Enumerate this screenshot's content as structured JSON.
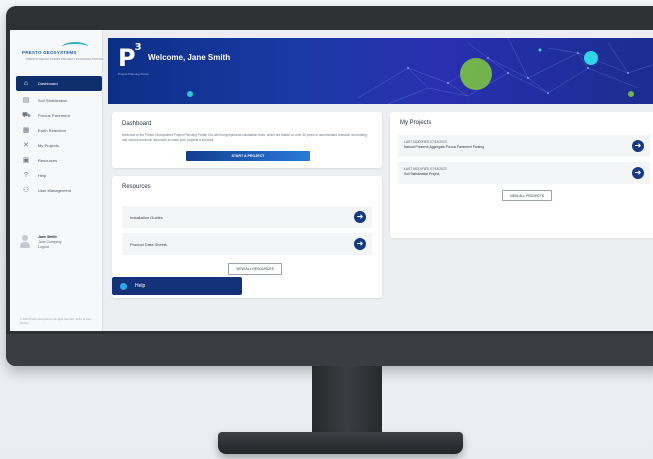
{
  "brand": {
    "logo_text": "PRESTO GEOSYSTEMS",
    "logo_sub": "PRESTO GEOSYSTEMS PROJECT PLANNING PORTAL"
  },
  "sidebar": {
    "items": [
      {
        "label": "Dashboard",
        "icon": "home-icon",
        "active": true
      },
      {
        "label": "Soil Stabilization",
        "icon": "layers-icon",
        "active": false
      },
      {
        "label": "Porous Pavement",
        "icon": "car-icon",
        "active": false
      },
      {
        "label": "Earth Retention",
        "icon": "wall-icon",
        "active": false
      },
      {
        "label": "My Projects",
        "icon": "projects-icon",
        "active": false
      },
      {
        "label": "Resources",
        "icon": "book-icon",
        "active": false
      },
      {
        "label": "Help",
        "icon": "question-icon",
        "active": false
      },
      {
        "label": "User Management",
        "icon": "users-icon",
        "active": false
      }
    ],
    "user": {
      "name": "Jane Smith",
      "line2": "Jane Company",
      "line3": "Logout"
    },
    "copyright": "© 2024 Presto Geosystems. All rights reserved. Terms of Use | Privacy"
  },
  "hero": {
    "logo": "P",
    "logo_sup": "3",
    "logo_sub": "Project Planning Portal",
    "welcome": "Welcome, Jane Smith"
  },
  "dashboard": {
    "title": "Dashboard",
    "body": "Welcome to the Presto Geosystems Project Planning Portal! You will find geoproduct calculation tools, which are based on over 40 years of accumulated research and testing, and various technical resources to make your projects a success.",
    "start_label": "START A PROJECT"
  },
  "resources": {
    "title": "Resources",
    "rows": [
      "Installation Guides",
      "Product Data Sheets"
    ],
    "view_all": "VIEW ALL RESOURCES"
  },
  "projects": {
    "title": "My Projects",
    "rows": [
      {
        "meta": "LAST MODIFIED 07/13/2023",
        "name": "Natural Preserve Aggregate Porous Pavement Parking"
      },
      {
        "meta": "LAST MODIFIED 07/13/2023",
        "name": "Soil Stabilization Project"
      }
    ],
    "view_all": "VIEW ALL PROJECTS"
  },
  "help": {
    "label": "Help"
  },
  "colors": {
    "navy": "#0f2f6b",
    "accent_blue": "#2a7bd8",
    "hero_green": "#7cc242",
    "hero_cyan": "#2fd4e8"
  }
}
